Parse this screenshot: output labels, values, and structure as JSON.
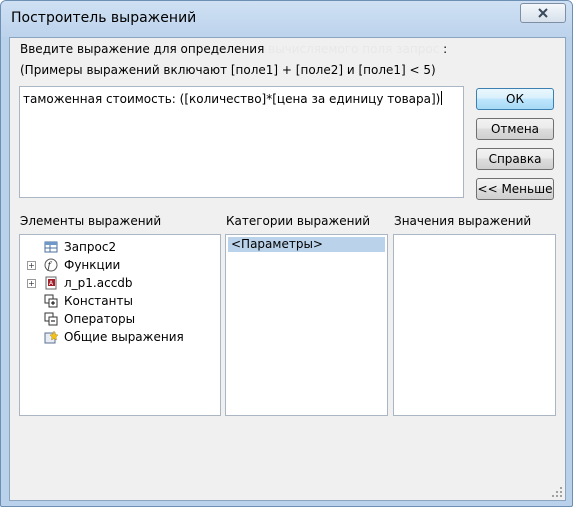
{
  "window": {
    "title": "Построитель выражений"
  },
  "prompt": {
    "line1_prefix": "Введите выражение для определения ",
    "line1_highlight": "вычисляемого поля запрос",
    "line1_suffix": ":",
    "line2": "(Примеры выражений включают [поле1] + [поле2] и [поле1] < 5)"
  },
  "expression": {
    "value": "таможенная стоимость: ([количество]*[цена за единицу товара])"
  },
  "buttons": {
    "ok": "ОК",
    "cancel": "Отмена",
    "help": "Справка",
    "less": "<< Меньше"
  },
  "panels": {
    "elements": {
      "label": "Элементы выражений",
      "items": [
        {
          "label": "Запрос2",
          "icon": "query-icon",
          "expandable": false
        },
        {
          "label": "Функции",
          "icon": "function-icon",
          "expandable": true
        },
        {
          "label": "л_р1.accdb",
          "icon": "database-icon",
          "expandable": true
        },
        {
          "label": "Константы",
          "icon": "constants-icon",
          "expandable": false
        },
        {
          "label": "Операторы",
          "icon": "operators-icon",
          "expandable": false
        },
        {
          "label": "Общие выражения",
          "icon": "common-expressions-icon",
          "expandable": false
        }
      ]
    },
    "categories": {
      "label": "Категории выражений",
      "items": [
        "<Параметры>"
      ]
    },
    "values": {
      "label": "Значения выражений",
      "items": []
    }
  },
  "colors": {
    "frame": "#b9d1ea",
    "selection": "#bbd3ea",
    "client": "#f0f0f0"
  }
}
